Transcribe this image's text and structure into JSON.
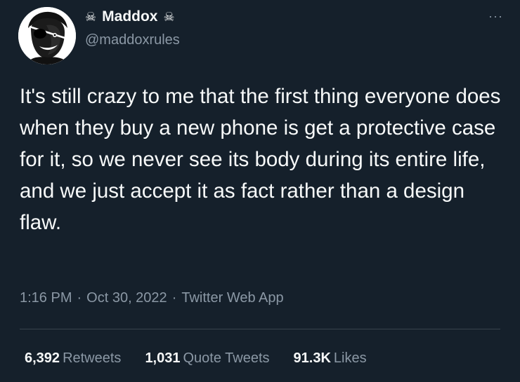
{
  "author": {
    "display_name": "Maddox",
    "handle": "@maddoxrules",
    "name_emoji_left": "☠",
    "name_emoji_right": "☠",
    "avatar_icon": "eyepatch-portrait-avatar"
  },
  "more_label": "···",
  "tweet": {
    "text": "It's still crazy to me that the first thing everyone does when they buy a new phone is get a protective case for it, so we never see its body during its entire life, and we just accept it as fact rather than a design flaw."
  },
  "meta": {
    "time": "1:16 PM",
    "date": "Oct 30, 2022",
    "source": "Twitter Web App",
    "separator": "·"
  },
  "stats": {
    "retweets_count": "6,392",
    "retweets_label": "Retweets",
    "quotes_count": "1,031",
    "quotes_label": "Quote Tweets",
    "likes_count": "91.3K",
    "likes_label": "Likes"
  },
  "colors": {
    "background": "#15202b",
    "text_primary": "#f7f9f9",
    "text_secondary": "#8b98a5",
    "divider": "#38444d"
  }
}
